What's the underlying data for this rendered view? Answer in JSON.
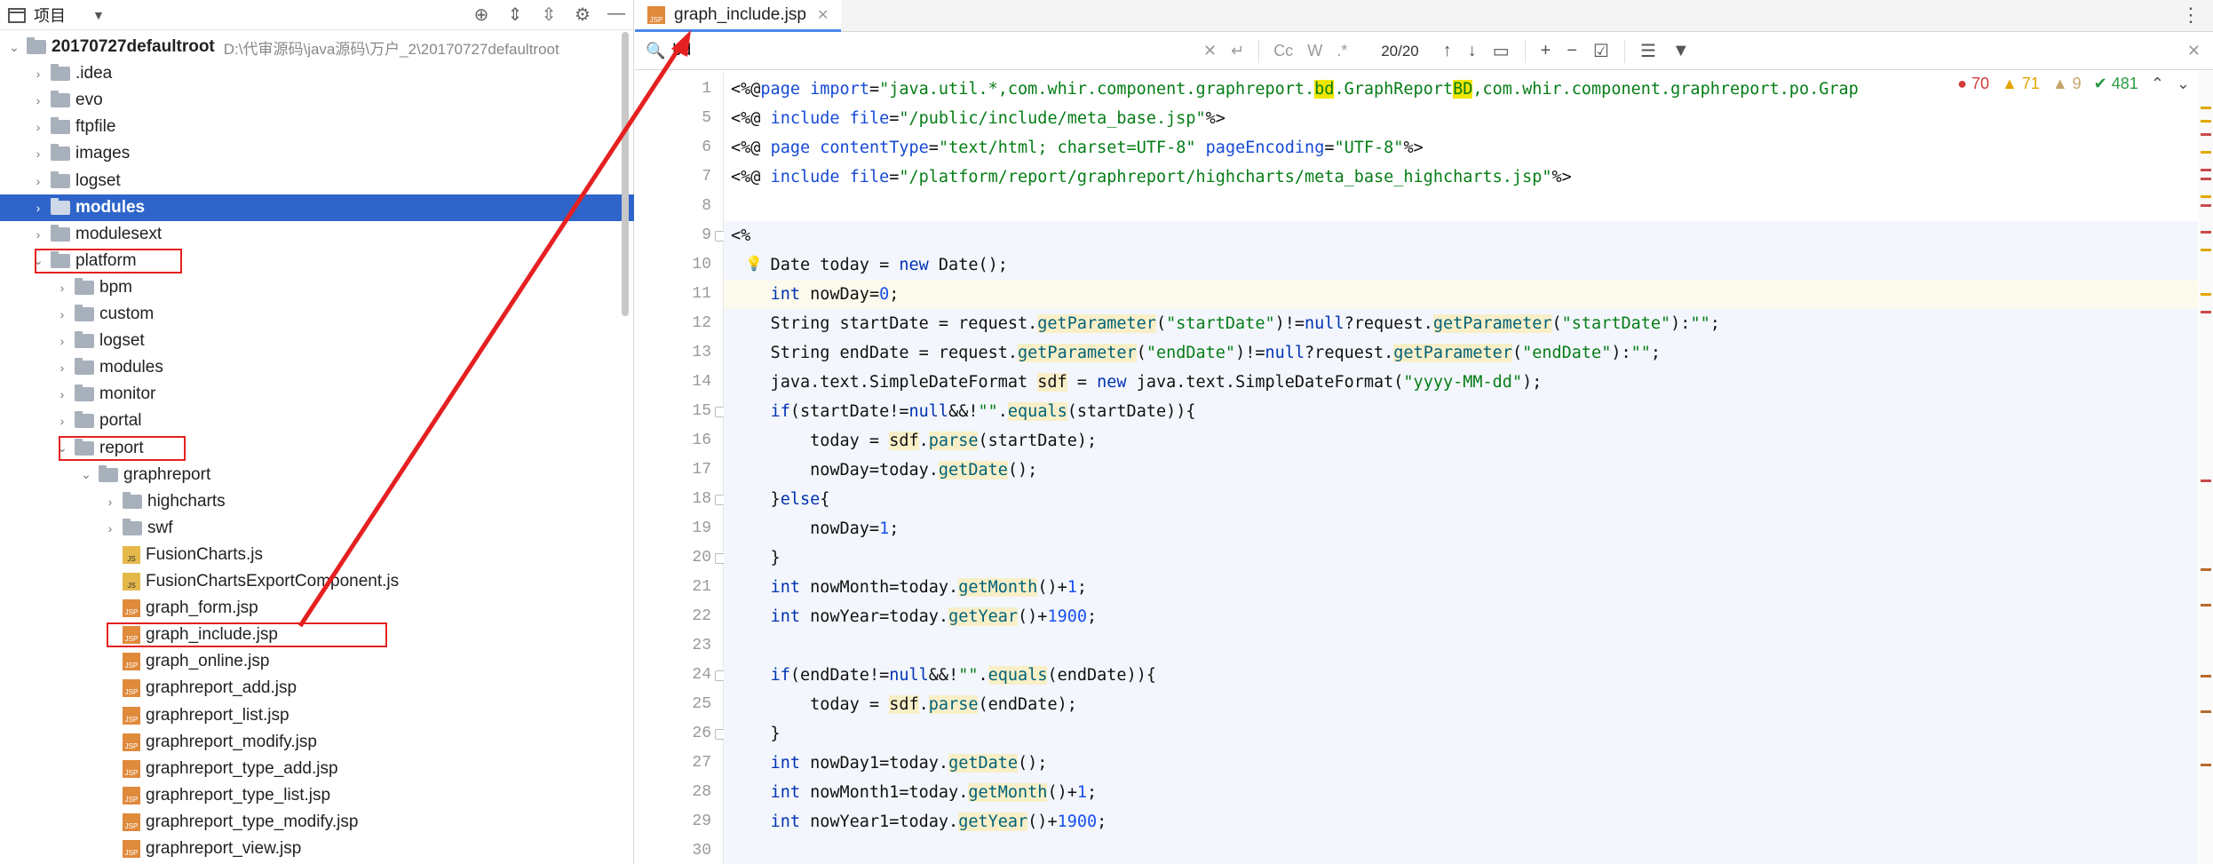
{
  "project_panel": {
    "title": "项目",
    "icons": [
      "locate-icon",
      "expand-icon",
      "collapse-icon",
      "gear-icon",
      "minimize-icon"
    ],
    "tree": [
      {
        "label": "20170727defaultroot",
        "path": "D:\\代审源码\\java源码\\万户_2\\20170727defaultroot",
        "depth": 0,
        "type": "module",
        "expanded": true,
        "bold": true
      },
      {
        "label": ".idea",
        "depth": 1,
        "type": "folder"
      },
      {
        "label": "evo",
        "depth": 1,
        "type": "folder"
      },
      {
        "label": "ftpfile",
        "depth": 1,
        "type": "folder"
      },
      {
        "label": "images",
        "depth": 1,
        "type": "folder"
      },
      {
        "label": "logset",
        "depth": 1,
        "type": "folder"
      },
      {
        "label": "modules",
        "depth": 1,
        "type": "folder",
        "selected": true,
        "bold": true
      },
      {
        "label": "modulesext",
        "depth": 1,
        "type": "folder"
      },
      {
        "label": "platform",
        "depth": 1,
        "type": "folder",
        "expanded": true,
        "highlight": true
      },
      {
        "label": "bpm",
        "depth": 2,
        "type": "folder"
      },
      {
        "label": "custom",
        "depth": 2,
        "type": "folder"
      },
      {
        "label": "logset",
        "depth": 2,
        "type": "folder"
      },
      {
        "label": "modules",
        "depth": 2,
        "type": "folder"
      },
      {
        "label": "monitor",
        "depth": 2,
        "type": "folder"
      },
      {
        "label": "portal",
        "depth": 2,
        "type": "folder"
      },
      {
        "label": "report",
        "depth": 2,
        "type": "folder",
        "expanded": true,
        "highlight": true
      },
      {
        "label": "graphreport",
        "depth": 3,
        "type": "folder",
        "expanded": true
      },
      {
        "label": "highcharts",
        "depth": 4,
        "type": "folder"
      },
      {
        "label": "swf",
        "depth": 4,
        "type": "folder"
      },
      {
        "label": "FusionCharts.js",
        "depth": 4,
        "type": "js",
        "leaf": true
      },
      {
        "label": "FusionChartsExportComponent.js",
        "depth": 4,
        "type": "js",
        "leaf": true
      },
      {
        "label": "graph_form.jsp",
        "depth": 4,
        "type": "jsp",
        "leaf": true
      },
      {
        "label": "graph_include.jsp",
        "depth": 4,
        "type": "jsp",
        "leaf": true,
        "highlight": true
      },
      {
        "label": "graph_online.jsp",
        "depth": 4,
        "type": "jsp",
        "leaf": true
      },
      {
        "label": "graphreport_add.jsp",
        "depth": 4,
        "type": "jsp",
        "leaf": true
      },
      {
        "label": "graphreport_list.jsp",
        "depth": 4,
        "type": "jsp",
        "leaf": true
      },
      {
        "label": "graphreport_modify.jsp",
        "depth": 4,
        "type": "jsp",
        "leaf": true
      },
      {
        "label": "graphreport_type_add.jsp",
        "depth": 4,
        "type": "jsp",
        "leaf": true
      },
      {
        "label": "graphreport_type_list.jsp",
        "depth": 4,
        "type": "jsp",
        "leaf": true
      },
      {
        "label": "graphreport_type_modify.jsp",
        "depth": 4,
        "type": "jsp",
        "leaf": true
      },
      {
        "label": "graphreport_view.jsp",
        "depth": 4,
        "type": "jsp",
        "leaf": true
      }
    ]
  },
  "editor": {
    "tab_label": "graph_include.jsp",
    "find": {
      "value": "bd",
      "count": "20/20",
      "options": [
        "Cc",
        "W",
        ".*"
      ]
    },
    "inspections": {
      "errors": "70",
      "warnings": "71",
      "weak": "9",
      "ok": "481"
    },
    "lines": [
      {
        "n": "1",
        "text": "<%@page import=\"java.util.*,com.whir.component.graphreport.bd.GraphReportBD,com.whir.component.graphreport.po.Grap"
      },
      {
        "n": "5",
        "text": "<%@ include file=\"/public/include/meta_base.jsp\"%>"
      },
      {
        "n": "6",
        "text": "<%@ page contentType=\"text/html; charset=UTF-8\" pageEncoding=\"UTF-8\"%>"
      },
      {
        "n": "7",
        "text": "<%@ include file=\"/platform/report/graphreport/highcharts/meta_base_highcharts.jsp\"%>"
      },
      {
        "n": "8",
        "text": ""
      },
      {
        "n": "9",
        "text": "<%"
      },
      {
        "n": "10",
        "text": "    Date today = new Date();"
      },
      {
        "n": "11",
        "text": "    int nowDay=0;"
      },
      {
        "n": "12",
        "text": "    String startDate = request.getParameter(\"startDate\")!=null?request.getParameter(\"startDate\"):\"\";"
      },
      {
        "n": "13",
        "text": "    String endDate = request.getParameter(\"endDate\")!=null?request.getParameter(\"endDate\"):\"\";"
      },
      {
        "n": "14",
        "text": "    java.text.SimpleDateFormat sdf = new java.text.SimpleDateFormat(\"yyyy-MM-dd\");"
      },
      {
        "n": "15",
        "text": "    if(startDate!=null&&!\"\".equals(startDate)){"
      },
      {
        "n": "16",
        "text": "        today = sdf.parse(startDate);"
      },
      {
        "n": "17",
        "text": "        nowDay=today.getDate();"
      },
      {
        "n": "18",
        "text": "    }else{"
      },
      {
        "n": "19",
        "text": "        nowDay=1;"
      },
      {
        "n": "20",
        "text": "    }"
      },
      {
        "n": "21",
        "text": "    int nowMonth=today.getMonth()+1;"
      },
      {
        "n": "22",
        "text": "    int nowYear=today.getYear()+1900;"
      },
      {
        "n": "23",
        "text": ""
      },
      {
        "n": "24",
        "text": "    if(endDate!=null&&!\"\".equals(endDate)){"
      },
      {
        "n": "25",
        "text": "        today = sdf.parse(endDate);"
      },
      {
        "n": "26",
        "text": "    }"
      },
      {
        "n": "27",
        "text": "    int nowDay1=today.getDate();"
      },
      {
        "n": "28",
        "text": "    int nowMonth1=today.getMonth()+1;"
      },
      {
        "n": "29",
        "text": "    int nowYear1=today.getYear()+1900;"
      },
      {
        "n": "30",
        "text": ""
      }
    ]
  },
  "colors": {
    "selection": "#2f65ca",
    "highlight_box": "#e52020",
    "keyword": "#0033b3",
    "string": "#067d17",
    "number": "#1750eb",
    "match": "#f2e600"
  }
}
